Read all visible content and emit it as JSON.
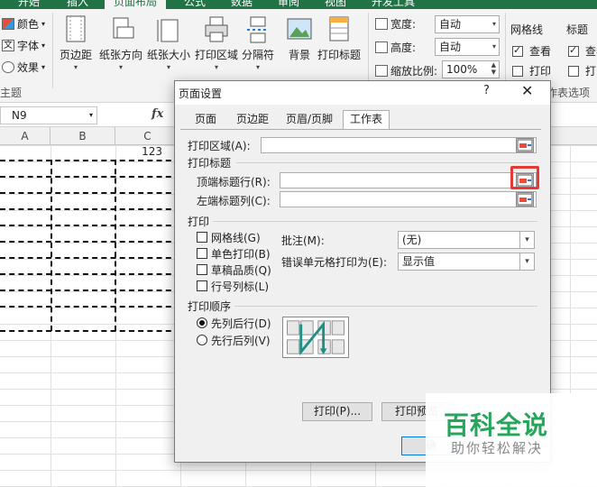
{
  "top_tabs": [
    "开始",
    "插入",
    "页面布局",
    "公式",
    "数据",
    "审阅",
    "视图",
    "开发工具"
  ],
  "ribbon": {
    "theme_items": [
      "颜色",
      "字体",
      "效果"
    ],
    "theme_group_label": "主题",
    "buttons": [
      "页边距",
      "纸张方向",
      "纸张大小",
      "打印区域",
      "分隔符",
      "背景",
      "打印标题"
    ],
    "scale": {
      "width_label": "宽度:",
      "width_value": "自动",
      "height_label": "高度:",
      "height_value": "自动",
      "zoom_label": "缩放比例:",
      "zoom_value": "100%"
    },
    "gridlines": {
      "label": "网格线",
      "view": "查看",
      "print": "打印",
      "view_checked": true,
      "print_checked": false
    },
    "headings": {
      "label": "标题",
      "view": "查看",
      "print": "打印",
      "view_checked": true,
      "print_checked": false
    },
    "sheet_options_label": "工作表选项"
  },
  "formula_bar": {
    "name_box": "N9",
    "fx": "fx"
  },
  "sheet": {
    "columns": [
      "A",
      "B",
      "C"
    ],
    "cell_value": "123"
  },
  "dialog": {
    "title": "页面设置",
    "help": "?",
    "close": "✕",
    "tabs": [
      "页面",
      "页边距",
      "页眉/页脚",
      "工作表"
    ],
    "active_tab": "工作表",
    "print_area_label": "打印区域(A):",
    "print_titles_label": "打印标题",
    "top_rows_label": "顶端标题行(R):",
    "left_cols_label": "左端标题列(C):",
    "print_section_label": "打印",
    "print_options": [
      {
        "label": "网格线(G)",
        "checked": false
      },
      {
        "label": "单色打印(B)",
        "checked": false
      },
      {
        "label": "草稿品质(Q)",
        "checked": false
      },
      {
        "label": "行号列标(L)",
        "checked": false
      }
    ],
    "comments_label": "批注(M):",
    "comments_value": "(无)",
    "errors_label": "错误单元格打印为(E):",
    "errors_value": "显示值",
    "order_label": "打印顺序",
    "order_options": [
      {
        "label": "先列后行(D)",
        "selected": true
      },
      {
        "label": "先行后列(V)",
        "selected": false
      }
    ],
    "buttons": {
      "print": "打印(P)...",
      "preview": "打印预览",
      "ok": "确"
    }
  },
  "watermark": {
    "title": "百科全说",
    "subtitle": "助你轻松解决"
  },
  "colors": {
    "excel_green": "#217346",
    "highlight_red": "#e53935",
    "watermark_green": "#25a65a"
  }
}
